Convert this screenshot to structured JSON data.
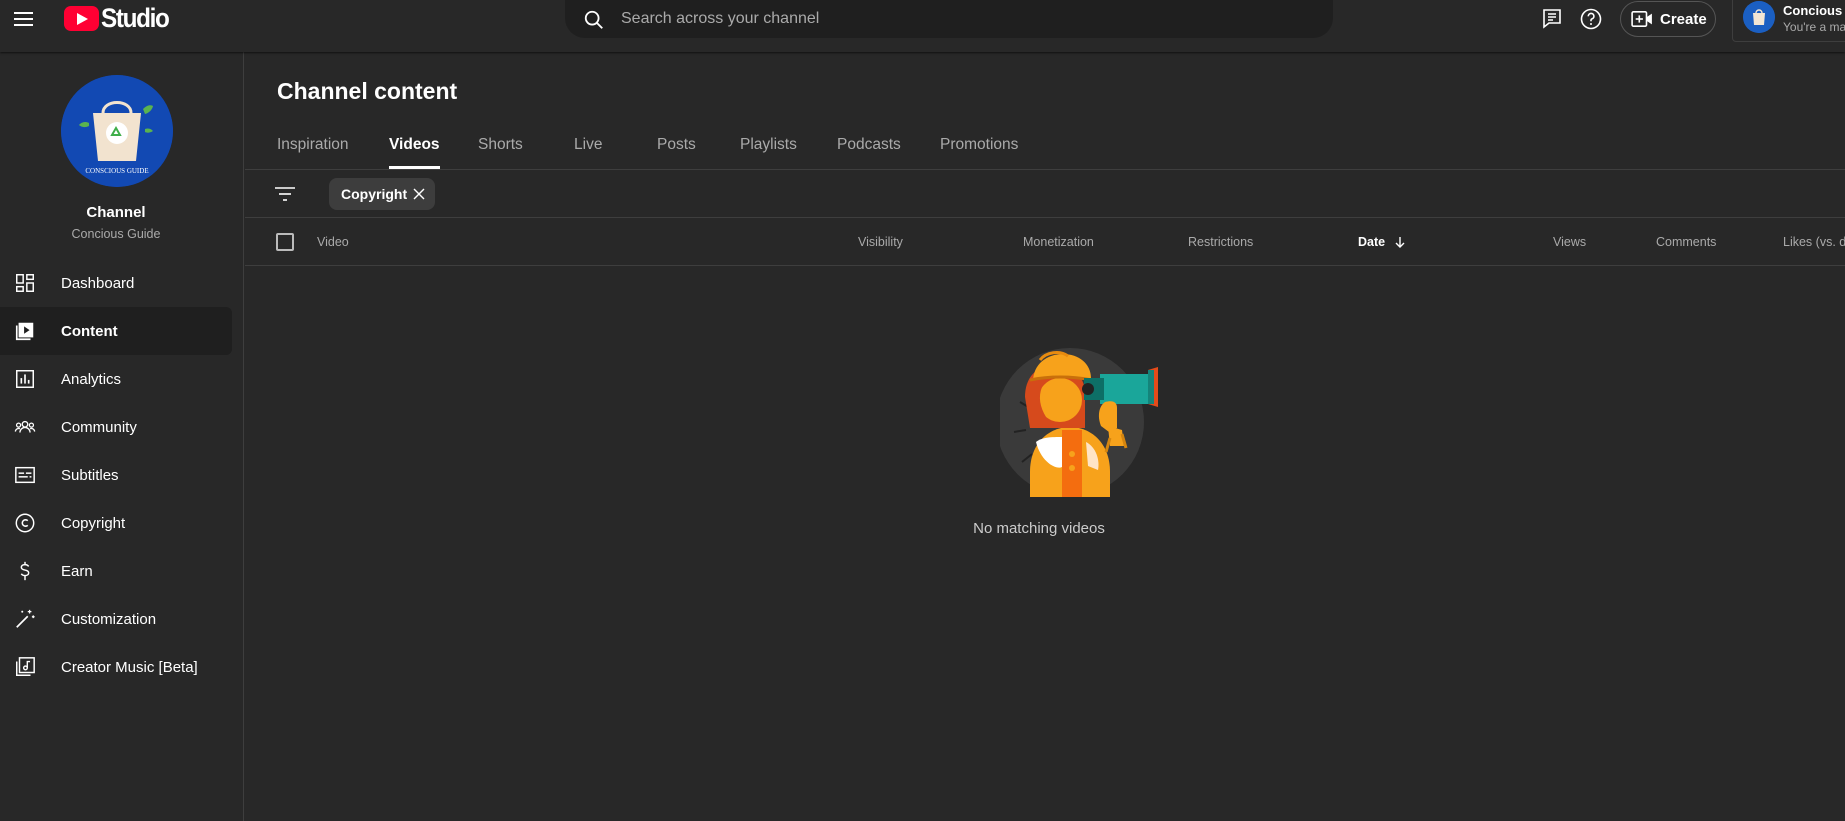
{
  "header": {
    "logo_text": "Studio",
    "search_placeholder": "Search across your channel",
    "create_label": "Create",
    "account_name": "Concious G",
    "account_sub": "You're a ma"
  },
  "sidebar": {
    "channel_title": "Channel",
    "channel_name": "Concious Guide",
    "avatar_caption": "CONSCIOUS GUIDE",
    "items": [
      {
        "label": "Dashboard",
        "icon": "dashboard-icon"
      },
      {
        "label": "Content",
        "icon": "content-icon",
        "active": true
      },
      {
        "label": "Analytics",
        "icon": "analytics-icon"
      },
      {
        "label": "Community",
        "icon": "community-icon"
      },
      {
        "label": "Subtitles",
        "icon": "subtitles-icon"
      },
      {
        "label": "Copyright",
        "icon": "copyright-icon"
      },
      {
        "label": "Earn",
        "icon": "earn-icon"
      },
      {
        "label": "Customization",
        "icon": "customization-icon"
      },
      {
        "label": "Creator Music [Beta]",
        "icon": "creator-music-icon"
      }
    ]
  },
  "main": {
    "title": "Channel content",
    "tabs": [
      {
        "label": "Inspiration"
      },
      {
        "label": "Videos",
        "active": true
      },
      {
        "label": "Shorts"
      },
      {
        "label": "Live"
      },
      {
        "label": "Posts"
      },
      {
        "label": "Playlists"
      },
      {
        "label": "Podcasts"
      },
      {
        "label": "Promotions"
      }
    ],
    "filter_chip": "Copyright",
    "columns": [
      "Video",
      "Visibility",
      "Monetization",
      "Restrictions",
      "Date",
      "Views",
      "Comments",
      "Likes (vs. d"
    ],
    "sorted_column": "Date",
    "empty_message": "No matching videos"
  },
  "colors": {
    "background": "#282828",
    "youtube_red": "#ff0033",
    "border": "#3e3e3e",
    "secondary_text": "#aaaaaa"
  }
}
